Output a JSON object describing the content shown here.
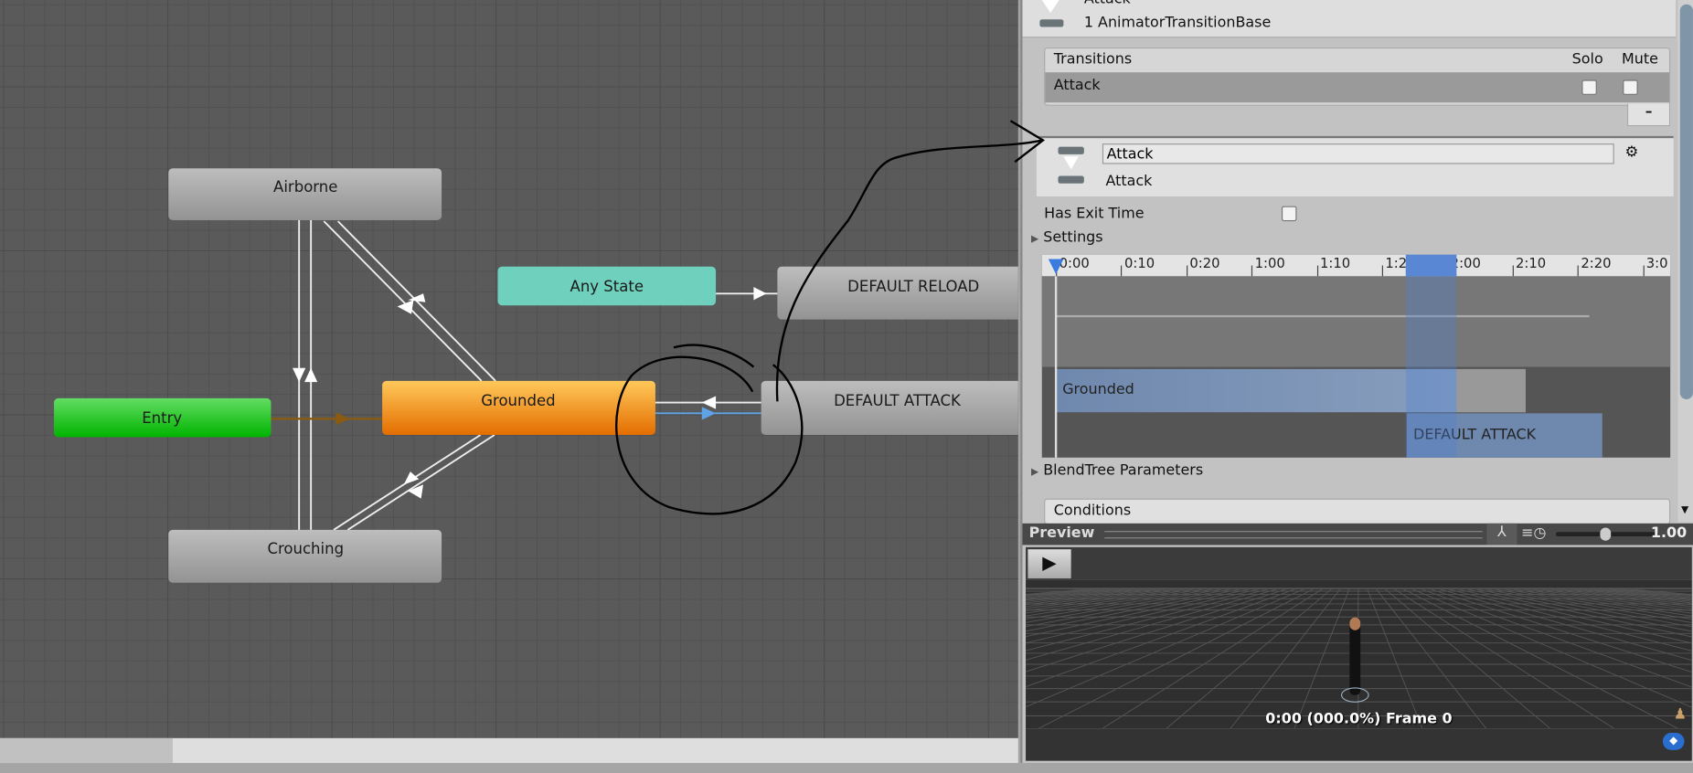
{
  "graph": {
    "nodes": {
      "airborne": "Airborne",
      "any_state": "Any State",
      "default_reload": "DEFAULT RELOAD",
      "entry": "Entry",
      "grounded": "Grounded",
      "default_attack": "DEFAULT ATTACK",
      "crouching": "Crouching"
    },
    "colors": {
      "entry": "#12c012",
      "grounded": "#f29a1e",
      "any_state": "#6fd1bd",
      "default": "#a8a8a8",
      "selected_transition": "#5fa3e6",
      "entry_transition": "#8a5a10"
    }
  },
  "inspector": {
    "header_title": "Attack",
    "header_subtitle": "1 AnimatorTransitionBase",
    "transitions": {
      "title": "Transitions",
      "solo": "Solo",
      "mute": "Mute",
      "rows": [
        {
          "label": "Attack",
          "solo": false,
          "mute": false
        }
      ],
      "remove_label": "–"
    },
    "transition": {
      "name_value": "Attack",
      "label": "Attack"
    },
    "has_exit_time": {
      "label": "Has Exit Time",
      "checked": false
    },
    "settings_label": "Settings",
    "timeline": {
      "ticks": [
        "0:00",
        "0:10",
        "0:20",
        "1:00",
        "1:10",
        "1:20",
        "2:00",
        "2:10",
        "2:20",
        "3:0"
      ],
      "source_state": "Grounded",
      "target_state": "DEFAULT ATTACK"
    },
    "blendtree_label": "BlendTree Parameters",
    "conditions_label": "Conditions"
  },
  "preview": {
    "title": "Preview",
    "speed": "1.00",
    "status": "0:00 (000.0%) Frame 0"
  }
}
